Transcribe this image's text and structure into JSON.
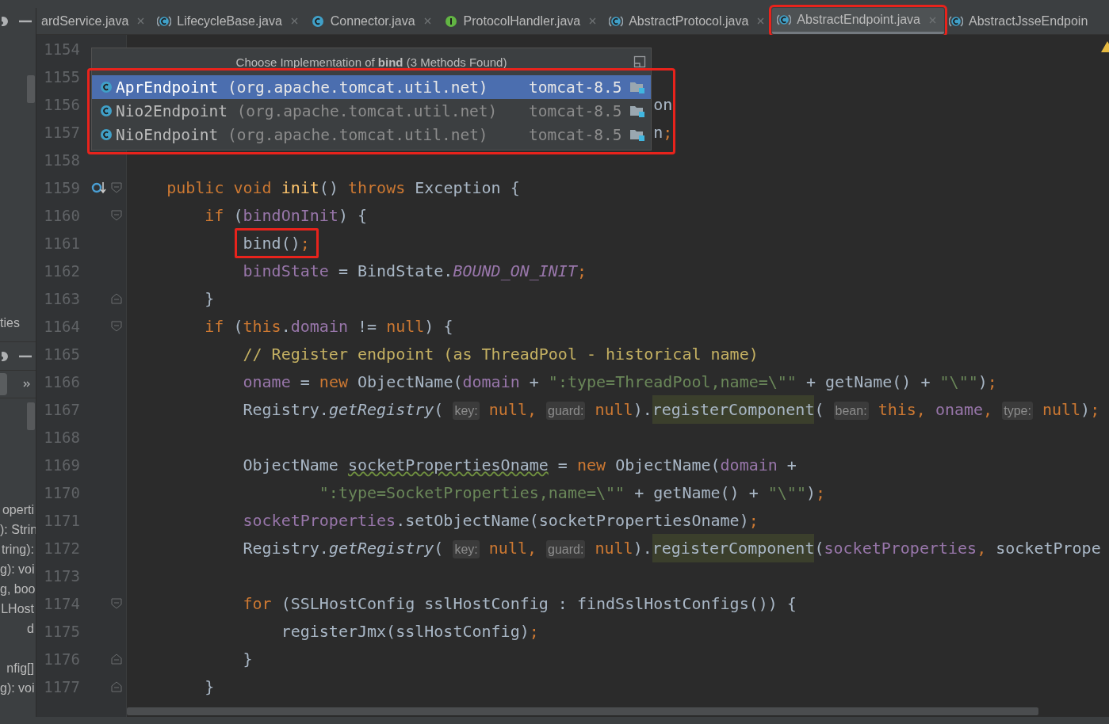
{
  "side_panel": {
    "top_label": "ties",
    "groups": [
      [
        "operti",
        "): Strin",
        "tring):",
        "g): voi",
        "g, boo",
        "LHost",
        "d"
      ],
      [
        "nfig[]",
        "g): voi"
      ]
    ]
  },
  "tabs": [
    {
      "label": "ardService.java",
      "kind": "none",
      "selected": false,
      "outlined": false,
      "closable": true
    },
    {
      "label": "LifecycleBase.java",
      "kind": "abstract",
      "selected": false,
      "outlined": false,
      "closable": true
    },
    {
      "label": "Connector.java",
      "kind": "class",
      "selected": false,
      "outlined": false,
      "closable": true
    },
    {
      "label": "ProtocolHandler.java",
      "kind": "interface",
      "selected": false,
      "outlined": false,
      "closable": true
    },
    {
      "label": "AbstractProtocol.java",
      "kind": "abstract",
      "selected": false,
      "outlined": false,
      "closable": true
    },
    {
      "label": "AbstractEndpoint.java",
      "kind": "abstract",
      "selected": true,
      "outlined": true,
      "closable": true
    },
    {
      "label": "AbstractJsseEndpoin",
      "kind": "abstract",
      "selected": false,
      "outlined": false,
      "closable": false
    }
  ],
  "editor": {
    "lines": [
      {
        "number": "1154"
      },
      {
        "number": "1155"
      },
      {
        "number": "1156",
        "code": [
          {
            "kind": "plain",
            "text": "                                                       on"
          }
        ]
      },
      {
        "number": "1157",
        "code": [
          {
            "kind": "plain",
            "text": "                                                       n"
          },
          {
            "kind": "keyword",
            "text": ";"
          }
        ]
      },
      {
        "number": "1158"
      },
      {
        "number": "1159",
        "fold_start": true,
        "marker": true,
        "code": [
          {
            "kind": "keyword",
            "text": "    public void "
          },
          {
            "kind": "method",
            "text": "init"
          },
          {
            "kind": "plain",
            "text": "() "
          },
          {
            "kind": "keyword",
            "text": "throws "
          },
          {
            "kind": "plain",
            "text": "Exception {"
          }
        ]
      },
      {
        "number": "1160",
        "fold_start": true,
        "code": [
          {
            "kind": "keyword",
            "text": "        if "
          },
          {
            "kind": "plain",
            "text": "("
          },
          {
            "kind": "field",
            "text": "bindOnInit"
          },
          {
            "kind": "plain",
            "text": ") {"
          }
        ]
      },
      {
        "number": "1161",
        "code": [
          {
            "kind": "plain",
            "text": "            bind()",
            "framed": true
          },
          {
            "kind": "keyword",
            "text": ";",
            "framed": true
          }
        ]
      },
      {
        "number": "1162",
        "code": [
          {
            "kind": "field",
            "text": "            bindState"
          },
          {
            "kind": "plain",
            "text": " = BindState."
          },
          {
            "kind": "constant",
            "text": "BOUND_ON_INIT"
          },
          {
            "kind": "keyword",
            "text": ";"
          }
        ]
      },
      {
        "number": "1163",
        "fold_end": true,
        "code": [
          {
            "kind": "plain",
            "text": "        }"
          }
        ]
      },
      {
        "number": "1164",
        "fold_start": true,
        "code": [
          {
            "kind": "keyword",
            "text": "        if "
          },
          {
            "kind": "plain",
            "text": "("
          },
          {
            "kind": "keyword",
            "text": "this"
          },
          {
            "kind": "plain",
            "text": "."
          },
          {
            "kind": "field",
            "text": "domain"
          },
          {
            "kind": "plain",
            "text": " != "
          },
          {
            "kind": "keyword",
            "text": "null"
          },
          {
            "kind": "plain",
            "text": ") {"
          }
        ]
      },
      {
        "number": "1165",
        "code": [
          {
            "kind": "comment",
            "text": "            // Register endpoint (as ThreadPool - historical name)"
          }
        ]
      },
      {
        "number": "1166",
        "code": [
          {
            "kind": "field",
            "text": "            oname"
          },
          {
            "kind": "plain",
            "text": " = "
          },
          {
            "kind": "keyword",
            "text": "new "
          },
          {
            "kind": "plain",
            "text": "ObjectName("
          },
          {
            "kind": "field",
            "text": "domain"
          },
          {
            "kind": "plain",
            "text": " + "
          },
          {
            "kind": "string",
            "text": "\":type=ThreadPool,name=\\\"\""
          },
          {
            "kind": "plain",
            "text": " + getName() + "
          },
          {
            "kind": "string",
            "text": "\"\\\"\""
          },
          {
            "kind": "plain",
            "text": ")"
          },
          {
            "kind": "keyword",
            "text": ";"
          }
        ]
      },
      {
        "number": "1167",
        "code": [
          {
            "kind": "plain",
            "text": "            Registry."
          },
          {
            "kind": "static",
            "text": "getRegistry"
          },
          {
            "kind": "plain",
            "text": "( "
          },
          {
            "kind": "hint",
            "text": "key:"
          },
          {
            "kind": "keyword",
            "text": " null, "
          },
          {
            "kind": "hint",
            "text": "guard:"
          },
          {
            "kind": "keyword",
            "text": " null"
          },
          {
            "kind": "plain",
            "text": ")."
          },
          {
            "kind": "call",
            "text": "registerComponent"
          },
          {
            "kind": "plain",
            "text": "( "
          },
          {
            "kind": "hint",
            "text": "bean:"
          },
          {
            "kind": "keyword",
            "text": " this, "
          },
          {
            "kind": "field",
            "text": "oname"
          },
          {
            "kind": "keyword",
            "text": ", "
          },
          {
            "kind": "hint",
            "text": "type:"
          },
          {
            "kind": "keyword",
            "text": " null"
          },
          {
            "kind": "plain",
            "text": ")"
          },
          {
            "kind": "keyword",
            "text": ";"
          }
        ]
      },
      {
        "number": "1168"
      },
      {
        "number": "1169",
        "code": [
          {
            "kind": "plain",
            "text": "            ObjectName "
          },
          {
            "kind": "typo",
            "text": "socketPropertiesOname"
          },
          {
            "kind": "plain",
            "text": " = "
          },
          {
            "kind": "keyword",
            "text": "new "
          },
          {
            "kind": "plain",
            "text": "ObjectName("
          },
          {
            "kind": "field",
            "text": "domain"
          },
          {
            "kind": "plain",
            "text": " +"
          }
        ]
      },
      {
        "number": "1170",
        "code": [
          {
            "kind": "string",
            "text": "                    \":type=SocketProperties,name=\\\"\""
          },
          {
            "kind": "plain",
            "text": " + getName() + "
          },
          {
            "kind": "string",
            "text": "\"\\\"\""
          },
          {
            "kind": "plain",
            "text": ")"
          },
          {
            "kind": "keyword",
            "text": ";"
          }
        ]
      },
      {
        "number": "1171",
        "code": [
          {
            "kind": "field",
            "text": "            socketProperties"
          },
          {
            "kind": "plain",
            "text": ".setObjectName(socketPropertiesOname)"
          },
          {
            "kind": "keyword",
            "text": ";"
          }
        ]
      },
      {
        "number": "1172",
        "code": [
          {
            "kind": "plain",
            "text": "            Registry."
          },
          {
            "kind": "static",
            "text": "getRegistry"
          },
          {
            "kind": "plain",
            "text": "( "
          },
          {
            "kind": "hint",
            "text": "key:"
          },
          {
            "kind": "keyword",
            "text": " null, "
          },
          {
            "kind": "hint",
            "text": "guard:"
          },
          {
            "kind": "keyword",
            "text": " null"
          },
          {
            "kind": "plain",
            "text": ")."
          },
          {
            "kind": "call",
            "text": "registerComponent"
          },
          {
            "kind": "plain",
            "text": "("
          },
          {
            "kind": "field",
            "text": "socketProperties"
          },
          {
            "kind": "keyword",
            "text": ", "
          },
          {
            "kind": "plain",
            "text": "socketPrope"
          }
        ]
      },
      {
        "number": "1173"
      },
      {
        "number": "1174",
        "fold_start": true,
        "code": [
          {
            "kind": "keyword",
            "text": "            for "
          },
          {
            "kind": "plain",
            "text": "(SSLHostConfig sslHostConfig : findSslHostConfigs()) {"
          }
        ]
      },
      {
        "number": "1175",
        "code": [
          {
            "kind": "plain",
            "text": "                registerJmx(sslHostConfig)"
          },
          {
            "kind": "keyword",
            "text": ";"
          }
        ]
      },
      {
        "number": "1176",
        "fold_end": true,
        "code": [
          {
            "kind": "plain",
            "text": "            }"
          }
        ]
      },
      {
        "number": "1177",
        "fold_end": true,
        "code": [
          {
            "kind": "plain",
            "text": "        }"
          }
        ]
      }
    ],
    "popup": {
      "title": "Choose Implementation of **bind** (3 Methods Found)",
      "outlined": true,
      "items": [
        {
          "name": "AprEndpoint",
          "package": "(org.apache.tomcat.util.net)",
          "module": "tomcat-8.5",
          "selected": true
        },
        {
          "name": "Nio2Endpoint",
          "package": "(org.apache.tomcat.util.net)",
          "module": "tomcat-8.5",
          "selected": false
        },
        {
          "name": "NioEndpoint",
          "package": "(org.apache.tomcat.util.net)",
          "module": "tomcat-8.5",
          "selected": false
        }
      ]
    }
  }
}
